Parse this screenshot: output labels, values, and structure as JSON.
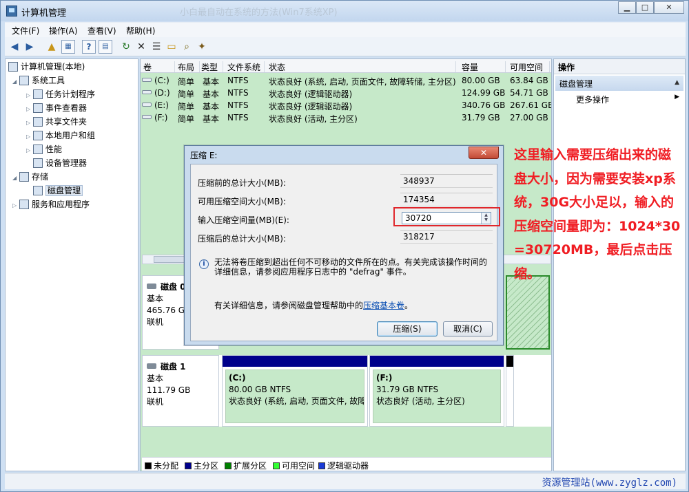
{
  "window": {
    "title": "计算机管理",
    "ghost_title": "小白最自动在系统的方法(Win7系统XP)",
    "min_label": "▁",
    "max_label": "□",
    "close_label": "✕"
  },
  "menu": [
    "文件(F)",
    "操作(A)",
    "查看(V)",
    "帮助(H)"
  ],
  "toolbar_icons": [
    "back-arrow-icon",
    "forward-arrow-icon",
    "up-folder-icon",
    "show-hide-tree-icon",
    "help-icon",
    "console-icon",
    "refresh-icon",
    "delete-icon",
    "properties-icon",
    "open-icon",
    "search-icon",
    "wizard-icon"
  ],
  "tree": {
    "root": "计算机管理(本地)",
    "system_tools": "系统工具",
    "task_scheduler": "任务计划程序",
    "event_viewer": "事件查看器",
    "shared_folders": "共享文件夹",
    "local_users": "本地用户和组",
    "performance": "性能",
    "device_manager": "设备管理器",
    "storage": "存储",
    "disk_management": "磁盘管理",
    "services_apps": "服务和应用程序"
  },
  "volume_table": {
    "headers": [
      "卷",
      "布局",
      "类型",
      "文件系统",
      "状态",
      "容量",
      "可用空间"
    ],
    "rows": [
      {
        "vol": "(C:)",
        "layout": "简单",
        "type": "基本",
        "fs": "NTFS",
        "status": "状态良好 (系统, 启动, 页面文件, 故障转储, 主分区)",
        "cap": "80.00 GB",
        "free": "63.84 GB"
      },
      {
        "vol": "(D:)",
        "layout": "简单",
        "type": "基本",
        "fs": "NTFS",
        "status": "状态良好 (逻辑驱动器)",
        "cap": "124.99 GB",
        "free": "54.71 GB"
      },
      {
        "vol": "(E:)",
        "layout": "简单",
        "type": "基本",
        "fs": "NTFS",
        "status": "状态良好 (逻辑驱动器)",
        "cap": "340.76 GB",
        "free": "267.61 GB"
      },
      {
        "vol": "(F:)",
        "layout": "简单",
        "type": "基本",
        "fs": "NTFS",
        "status": "状态良好 (活动, 主分区)",
        "cap": "31.79 GB",
        "free": "27.00 GB"
      }
    ]
  },
  "disk0": {
    "name": "磁盘 0",
    "type": "基本",
    "size": "465.76 GB",
    "state": "联机"
  },
  "disk1": {
    "name": "磁盘 1",
    "type": "基本",
    "size": "111.79 GB",
    "state": "联机",
    "partitions": [
      {
        "label": "(C:)",
        "size": "80.00 GB NTFS",
        "status": "状态良好 (系统, 启动, 页面文件, 故障"
      },
      {
        "label": "(F:)",
        "size": "31.79 GB NTFS",
        "status": "状态良好 (活动, 主分区)"
      }
    ]
  },
  "legend": [
    {
      "label": "未分配",
      "color": "#000000"
    },
    {
      "label": "主分区",
      "color": "#00008b"
    },
    {
      "label": "扩展分区",
      "color": "#008000"
    },
    {
      "label": "可用空间",
      "color": "#33ff33"
    },
    {
      "label": "逻辑驱动器",
      "color": "#1a3bd6"
    }
  ],
  "actions": {
    "header": "操作",
    "section": "磁盘管理",
    "more": "更多操作"
  },
  "dialog": {
    "title": "压缩 E:",
    "close_label": "✕",
    "total_before_label": "压缩前的总计大小(MB):",
    "total_before_value": "348937",
    "available_label": "可用压缩空间大小(MB):",
    "available_value": "174354",
    "input_label": "输入压缩空间量(MB)(E):",
    "input_value": "30720",
    "total_after_label": "压缩后的总计大小(MB):",
    "total_after_value": "318217",
    "info_text": "无法将卷压缩到超出任何不可移动的文件所在的点。有关完成该操作时间的详细信息，请参阅应用程序日志中的 \"defrag\" 事件。",
    "help_prefix": "有关详细信息，请参阅磁盘管理帮助中的",
    "help_link": "压缩基本卷",
    "help_suffix": "。",
    "compress_button": "压缩(S)",
    "cancel_button": "取消(C)"
  },
  "annotation": "这里输入需要压缩出来的磁盘大小，因为需要安装xp系统，30G大小足以，输入的压缩空间量即为：1024*30=30720MB，最后点击压缩。",
  "watermark": "资源管理站(www.zyglz.com)"
}
